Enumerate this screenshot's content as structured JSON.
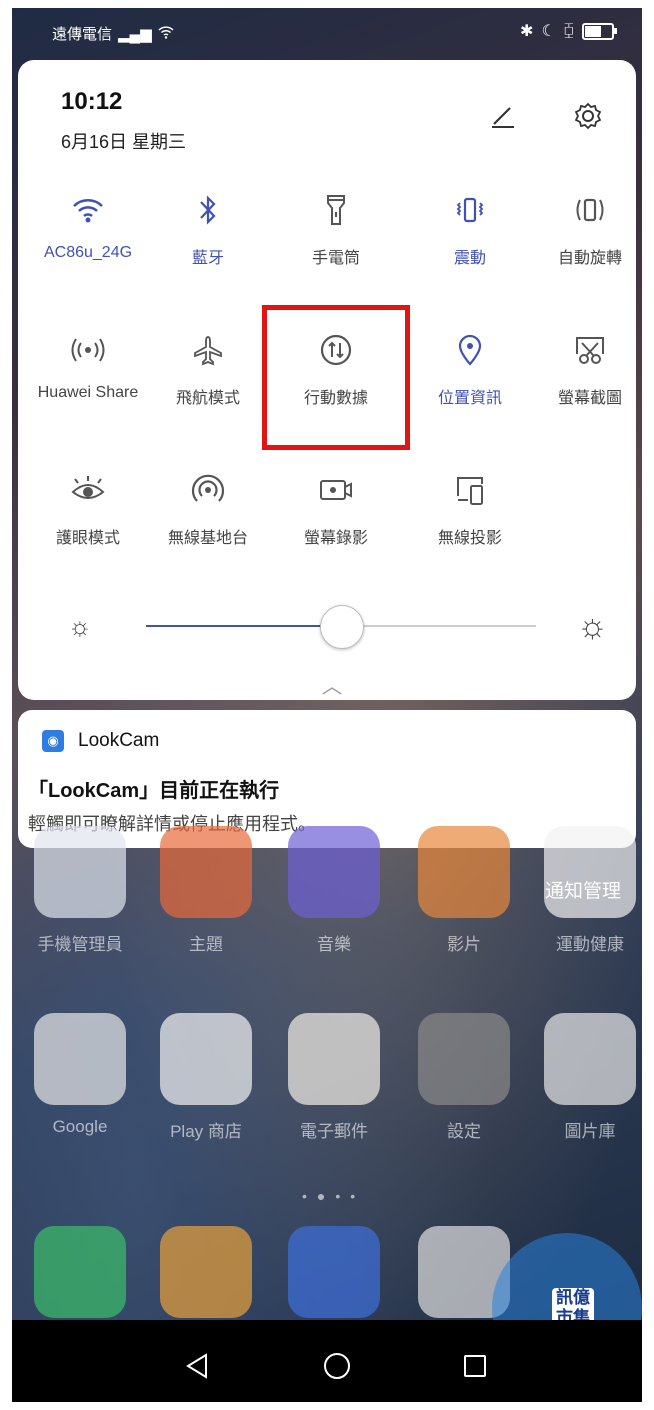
{
  "status_bar": {
    "carrier": "遠傳電信"
  },
  "quick_settings": {
    "time": "10:12",
    "date": "6月16日 星期三",
    "tiles": [
      {
        "label": "AC86u_24G",
        "icon": "wifi-icon",
        "active": true
      },
      {
        "label": "藍牙",
        "icon": "bluetooth-icon",
        "active": true
      },
      {
        "label": "手電筒",
        "icon": "flashlight-icon",
        "active": false
      },
      {
        "label": "震動",
        "icon": "vibrate-icon",
        "active": true
      },
      {
        "label": "自動旋轉",
        "icon": "rotate-icon",
        "active": false
      },
      {
        "label": "Huawei Share",
        "icon": "huawei-share-icon",
        "active": false
      },
      {
        "label": "飛航模式",
        "icon": "airplane-icon",
        "active": false
      },
      {
        "label": "行動數據",
        "icon": "mobile-data-icon",
        "active": false
      },
      {
        "label": "位置資訊",
        "icon": "location-icon",
        "active": true
      },
      {
        "label": "螢幕截圖",
        "icon": "screenshot-icon",
        "active": false
      },
      {
        "label": "護眼模式",
        "icon": "eye-comfort-icon",
        "active": false
      },
      {
        "label": "無線基地台",
        "icon": "hotspot-icon",
        "active": false
      },
      {
        "label": "螢幕錄影",
        "icon": "screen-record-icon",
        "active": false
      },
      {
        "label": "無線投影",
        "icon": "wireless-projection-icon",
        "active": false
      }
    ],
    "brightness": 0.5
  },
  "notification": {
    "app": "LookCam",
    "title": "「LookCam」目前正在執行",
    "body": "輕觸即可瞭解詳情或停止應用程式。"
  },
  "home": {
    "row1": [
      {
        "label": "手機管理員",
        "color": "#dfe6ee"
      },
      {
        "label": "主題",
        "color": "#e86a3b"
      },
      {
        "label": "音樂",
        "color": "#6d5fd6"
      },
      {
        "label": "影片",
        "color": "#e8883a"
      },
      {
        "label": "運動健康",
        "color": "#f2f2f2"
      }
    ],
    "notice_label": "通知管理",
    "row2": [
      {
        "label": "Google",
        "color": "#e8e8e8"
      },
      {
        "label": "Play 商店",
        "color": "#f4f4f4"
      },
      {
        "label": "電子郵件",
        "color": "#f4f0e8"
      },
      {
        "label": "設定",
        "color": "#8a8a8a"
      },
      {
        "label": "圖片庫",
        "color": "#e8e8e8"
      }
    ],
    "dock": [
      {
        "label": "",
        "color": "#3bbf6a"
      },
      {
        "label": "",
        "color": "#e9a13a"
      },
      {
        "label": "",
        "color": "#3d6fdc"
      },
      {
        "label": "",
        "color": "#e0e0e0"
      },
      {
        "label": "",
        "color": "#e0e0e0"
      }
    ]
  },
  "watermark": {
    "text": "訊億 市集"
  },
  "colors": {
    "accent": "#3f51b5",
    "highlight": "#e31414"
  }
}
